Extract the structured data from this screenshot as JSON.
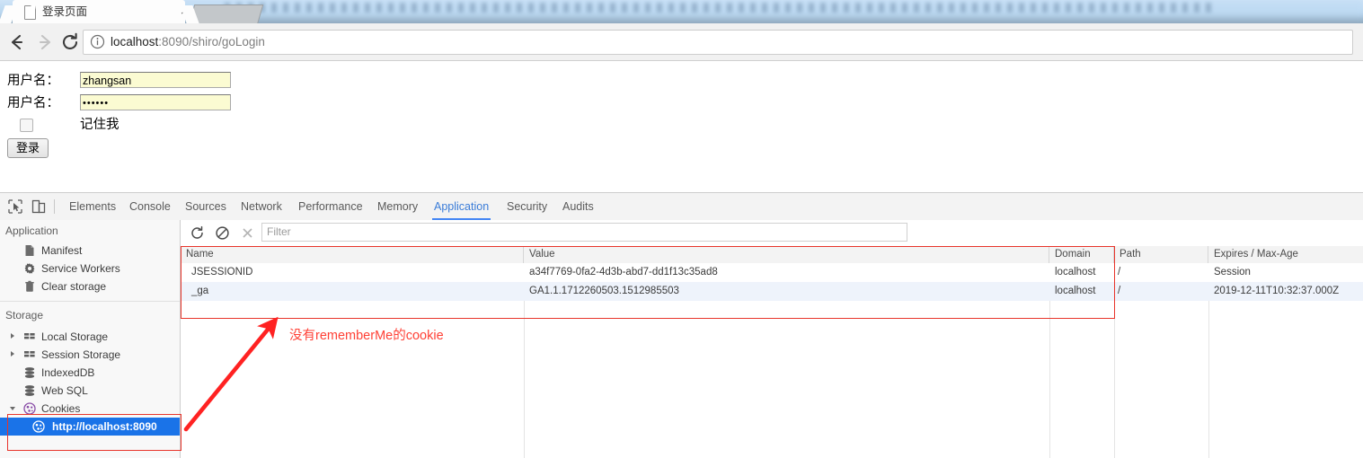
{
  "browser": {
    "tab": {
      "title": "登录页面",
      "close_label": "×",
      "favicon": "page-icon"
    },
    "nav": {
      "back": "back-arrow-icon",
      "forward": "forward-arrow-icon",
      "reload": "reload-icon",
      "info": "info-circle-icon",
      "url_prefix": "localhost",
      "url_suffix": ":8090/shiro/goLogin",
      "url_full": "localhost:8090/shiro/goLogin"
    }
  },
  "page": {
    "username_label": "用户名：",
    "username_value": "zhangsan",
    "password_label": "用户名：",
    "password_value": "••••••",
    "remember_label": "记住我",
    "remember_checked": false,
    "submit_label": "登录"
  },
  "devtools": {
    "tabs": [
      {
        "label": "Elements",
        "active": false
      },
      {
        "label": "Console",
        "active": false
      },
      {
        "label": "Sources",
        "active": false
      },
      {
        "label": "Network",
        "active": false
      },
      {
        "label": "Performance",
        "active": false
      },
      {
        "label": "Memory",
        "active": false
      },
      {
        "label": "Application",
        "active": true
      },
      {
        "label": "Security",
        "active": false
      },
      {
        "label": "Audits",
        "active": false
      }
    ],
    "toolbar": {
      "inspect": "inspect-element-icon",
      "device": "device-toolbar-icon"
    },
    "sidebar": {
      "section_application": "Application",
      "application_items": [
        {
          "label": "Manifest",
          "icon": "manifest-icon"
        },
        {
          "label": "Service Workers",
          "icon": "gear-icon"
        },
        {
          "label": "Clear storage",
          "icon": "trash-icon"
        }
      ],
      "section_storage": "Storage",
      "storage_items": [
        {
          "label": "Local Storage",
          "icon": "table-icon",
          "expandable": true,
          "expanded": false,
          "selected": false
        },
        {
          "label": "Session Storage",
          "icon": "table-icon",
          "expandable": true,
          "expanded": false,
          "selected": false
        },
        {
          "label": "IndexedDB",
          "icon": "database-icon",
          "expandable": false,
          "expanded": false,
          "selected": false
        },
        {
          "label": "Web SQL",
          "icon": "database-icon",
          "expandable": false,
          "expanded": false,
          "selected": false
        },
        {
          "label": "Cookies",
          "icon": "cookie-icon",
          "expandable": true,
          "expanded": true,
          "selected": false
        },
        {
          "label": "http://localhost:8090",
          "icon": "cookie-icon",
          "expandable": false,
          "expanded": false,
          "selected": true
        }
      ]
    },
    "filterbar": {
      "refresh": "refresh-icon",
      "clear_all": "clear-all-icon",
      "delete": "close-x-icon",
      "filter_placeholder": "Filter",
      "filter_value": ""
    },
    "cookie_table": {
      "columns": [
        "Name",
        "Value",
        "Domain",
        "Path",
        "Expires / Max-Age"
      ],
      "rows": [
        {
          "name": "JSESSIONID",
          "value": "a34f7769-0fa2-4d3b-abd7-dd1f13c35ad8",
          "domain": "localhost",
          "path": "/",
          "expires": "Session"
        },
        {
          "name": "_ga",
          "value": "GA1.1.1712260503.1512985503",
          "domain": "localhost",
          "path": "/",
          "expires": "2019-12-11T10:32:37.000Z"
        }
      ]
    }
  },
  "annotation": {
    "text": "没有rememberMe的cookie",
    "color": "#ff4136",
    "arrow": "red-arrow-pointing-up-right"
  }
}
